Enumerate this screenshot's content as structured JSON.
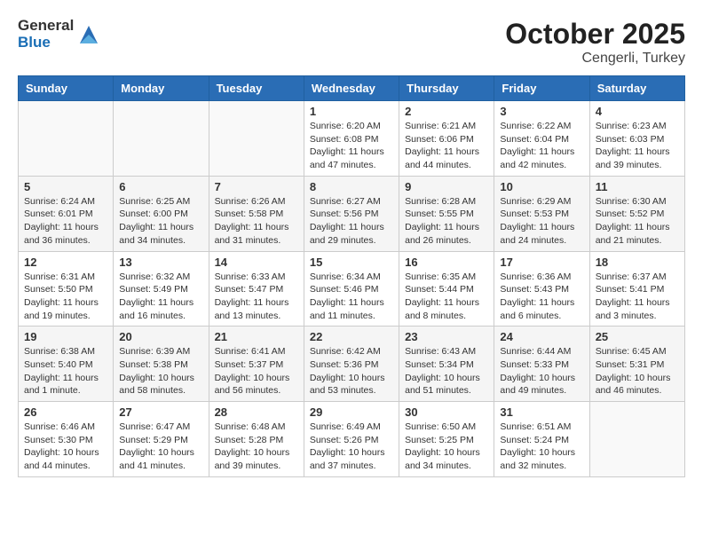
{
  "header": {
    "logo_general": "General",
    "logo_blue": "Blue",
    "title": "October 2025",
    "subtitle": "Cengerli, Turkey"
  },
  "days_of_week": [
    "Sunday",
    "Monday",
    "Tuesday",
    "Wednesday",
    "Thursday",
    "Friday",
    "Saturday"
  ],
  "weeks": [
    [
      {
        "day": "",
        "info": ""
      },
      {
        "day": "",
        "info": ""
      },
      {
        "day": "",
        "info": ""
      },
      {
        "day": "1",
        "info": "Sunrise: 6:20 AM\nSunset: 6:08 PM\nDaylight: 11 hours and 47 minutes."
      },
      {
        "day": "2",
        "info": "Sunrise: 6:21 AM\nSunset: 6:06 PM\nDaylight: 11 hours and 44 minutes."
      },
      {
        "day": "3",
        "info": "Sunrise: 6:22 AM\nSunset: 6:04 PM\nDaylight: 11 hours and 42 minutes."
      },
      {
        "day": "4",
        "info": "Sunrise: 6:23 AM\nSunset: 6:03 PM\nDaylight: 11 hours and 39 minutes."
      }
    ],
    [
      {
        "day": "5",
        "info": "Sunrise: 6:24 AM\nSunset: 6:01 PM\nDaylight: 11 hours and 36 minutes."
      },
      {
        "day": "6",
        "info": "Sunrise: 6:25 AM\nSunset: 6:00 PM\nDaylight: 11 hours and 34 minutes."
      },
      {
        "day": "7",
        "info": "Sunrise: 6:26 AM\nSunset: 5:58 PM\nDaylight: 11 hours and 31 minutes."
      },
      {
        "day": "8",
        "info": "Sunrise: 6:27 AM\nSunset: 5:56 PM\nDaylight: 11 hours and 29 minutes."
      },
      {
        "day": "9",
        "info": "Sunrise: 6:28 AM\nSunset: 5:55 PM\nDaylight: 11 hours and 26 minutes."
      },
      {
        "day": "10",
        "info": "Sunrise: 6:29 AM\nSunset: 5:53 PM\nDaylight: 11 hours and 24 minutes."
      },
      {
        "day": "11",
        "info": "Sunrise: 6:30 AM\nSunset: 5:52 PM\nDaylight: 11 hours and 21 minutes."
      }
    ],
    [
      {
        "day": "12",
        "info": "Sunrise: 6:31 AM\nSunset: 5:50 PM\nDaylight: 11 hours and 19 minutes."
      },
      {
        "day": "13",
        "info": "Sunrise: 6:32 AM\nSunset: 5:49 PM\nDaylight: 11 hours and 16 minutes."
      },
      {
        "day": "14",
        "info": "Sunrise: 6:33 AM\nSunset: 5:47 PM\nDaylight: 11 hours and 13 minutes."
      },
      {
        "day": "15",
        "info": "Sunrise: 6:34 AM\nSunset: 5:46 PM\nDaylight: 11 hours and 11 minutes."
      },
      {
        "day": "16",
        "info": "Sunrise: 6:35 AM\nSunset: 5:44 PM\nDaylight: 11 hours and 8 minutes."
      },
      {
        "day": "17",
        "info": "Sunrise: 6:36 AM\nSunset: 5:43 PM\nDaylight: 11 hours and 6 minutes."
      },
      {
        "day": "18",
        "info": "Sunrise: 6:37 AM\nSunset: 5:41 PM\nDaylight: 11 hours and 3 minutes."
      }
    ],
    [
      {
        "day": "19",
        "info": "Sunrise: 6:38 AM\nSunset: 5:40 PM\nDaylight: 11 hours and 1 minute."
      },
      {
        "day": "20",
        "info": "Sunrise: 6:39 AM\nSunset: 5:38 PM\nDaylight: 10 hours and 58 minutes."
      },
      {
        "day": "21",
        "info": "Sunrise: 6:41 AM\nSunset: 5:37 PM\nDaylight: 10 hours and 56 minutes."
      },
      {
        "day": "22",
        "info": "Sunrise: 6:42 AM\nSunset: 5:36 PM\nDaylight: 10 hours and 53 minutes."
      },
      {
        "day": "23",
        "info": "Sunrise: 6:43 AM\nSunset: 5:34 PM\nDaylight: 10 hours and 51 minutes."
      },
      {
        "day": "24",
        "info": "Sunrise: 6:44 AM\nSunset: 5:33 PM\nDaylight: 10 hours and 49 minutes."
      },
      {
        "day": "25",
        "info": "Sunrise: 6:45 AM\nSunset: 5:31 PM\nDaylight: 10 hours and 46 minutes."
      }
    ],
    [
      {
        "day": "26",
        "info": "Sunrise: 6:46 AM\nSunset: 5:30 PM\nDaylight: 10 hours and 44 minutes."
      },
      {
        "day": "27",
        "info": "Sunrise: 6:47 AM\nSunset: 5:29 PM\nDaylight: 10 hours and 41 minutes."
      },
      {
        "day": "28",
        "info": "Sunrise: 6:48 AM\nSunset: 5:28 PM\nDaylight: 10 hours and 39 minutes."
      },
      {
        "day": "29",
        "info": "Sunrise: 6:49 AM\nSunset: 5:26 PM\nDaylight: 10 hours and 37 minutes."
      },
      {
        "day": "30",
        "info": "Sunrise: 6:50 AM\nSunset: 5:25 PM\nDaylight: 10 hours and 34 minutes."
      },
      {
        "day": "31",
        "info": "Sunrise: 6:51 AM\nSunset: 5:24 PM\nDaylight: 10 hours and 32 minutes."
      },
      {
        "day": "",
        "info": ""
      }
    ]
  ]
}
